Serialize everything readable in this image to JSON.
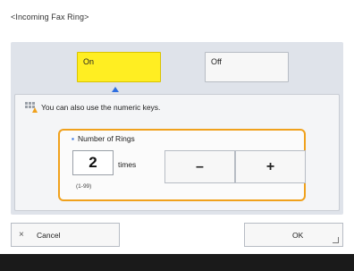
{
  "title": "<Incoming Fax Ring>",
  "toggle": {
    "on_label": "On",
    "off_label": "Off",
    "selected": "On"
  },
  "hint": {
    "text": "You can also use the numeric keys.",
    "icon": "numeric-keypad-icon"
  },
  "rings": {
    "label": "Number of Rings",
    "value": "2",
    "unit": "times",
    "range": "(1-99)",
    "minus_label": "–",
    "plus_label": "+"
  },
  "footer": {
    "cancel_icon": "×",
    "cancel_label": "Cancel",
    "ok_label": "OK"
  },
  "colors": {
    "selected_button": "#ffee22",
    "focus_border": "#f0a11c",
    "accent": "#2f6fe0",
    "panel_bg": "#dfe3ea",
    "bottom_bar": "#1a1a1a"
  }
}
